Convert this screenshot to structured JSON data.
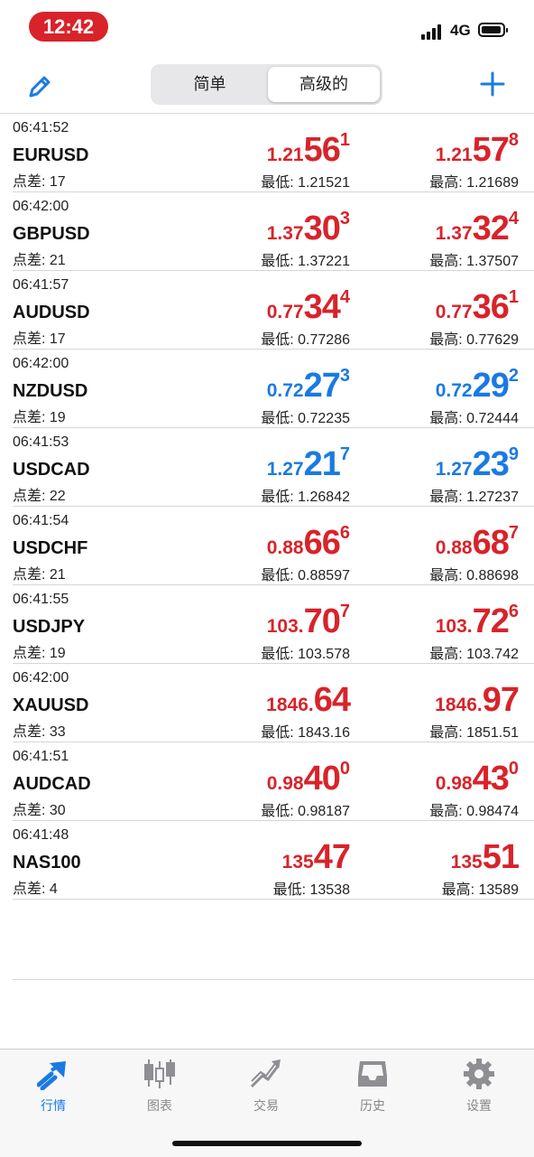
{
  "status": {
    "time": "12:42",
    "network": "4G"
  },
  "nav": {
    "segments": [
      "简单",
      "高级的"
    ],
    "selected_segment": "高级的",
    "edit_icon": "pencil-icon",
    "add_icon": "plus-icon"
  },
  "labels": {
    "low": "最低: ",
    "high": "最高: ",
    "spread": "点差: "
  },
  "quotes": [
    {
      "time": "06:41:52",
      "symbol": "EURUSD",
      "spread": "17",
      "color": "#d8232a",
      "bid": {
        "pre": "1.21",
        "big": "56",
        "sup": "1"
      },
      "ask": {
        "pre": "1.21",
        "big": "57",
        "sup": "8"
      },
      "low": "1.21521",
      "high": "1.21689"
    },
    {
      "time": "06:42:00",
      "symbol": "GBPUSD",
      "spread": "21",
      "color": "#d8232a",
      "bid": {
        "pre": "1.37",
        "big": "30",
        "sup": "3"
      },
      "ask": {
        "pre": "1.37",
        "big": "32",
        "sup": "4"
      },
      "low": "1.37221",
      "high": "1.37507"
    },
    {
      "time": "06:41:57",
      "symbol": "AUDUSD",
      "spread": "17",
      "color": "#d8232a",
      "bid": {
        "pre": "0.77",
        "big": "34",
        "sup": "4"
      },
      "ask": {
        "pre": "0.77",
        "big": "36",
        "sup": "1"
      },
      "low": "0.77286",
      "high": "0.77629"
    },
    {
      "time": "06:42:00",
      "symbol": "NZDUSD",
      "spread": "19",
      "color": "#1a7ae2",
      "bid": {
        "pre": "0.72",
        "big": "27",
        "sup": "3"
      },
      "ask": {
        "pre": "0.72",
        "big": "29",
        "sup": "2"
      },
      "low": "0.72235",
      "high": "0.72444"
    },
    {
      "time": "06:41:53",
      "symbol": "USDCAD",
      "spread": "22",
      "color": "#1a7ae2",
      "bid": {
        "pre": "1.27",
        "big": "21",
        "sup": "7"
      },
      "ask": {
        "pre": "1.27",
        "big": "23",
        "sup": "9"
      },
      "low": "1.26842",
      "high": "1.27237"
    },
    {
      "time": "06:41:54",
      "symbol": "USDCHF",
      "spread": "21",
      "color": "#d8232a",
      "bid": {
        "pre": "0.88",
        "big": "66",
        "sup": "6"
      },
      "ask": {
        "pre": "0.88",
        "big": "68",
        "sup": "7"
      },
      "low": "0.88597",
      "high": "0.88698"
    },
    {
      "time": "06:41:55",
      "symbol": "USDJPY",
      "spread": "19",
      "color": "#d8232a",
      "bid": {
        "pre": "103.",
        "big": "70",
        "sup": "7"
      },
      "ask": {
        "pre": "103.",
        "big": "72",
        "sup": "6"
      },
      "low": "103.578",
      "high": "103.742"
    },
    {
      "time": "06:42:00",
      "symbol": "XAUUSD",
      "spread": "33",
      "color": "#d8232a",
      "bid": {
        "pre": "1846.",
        "big": "64",
        "sup": ""
      },
      "ask": {
        "pre": "1846.",
        "big": "97",
        "sup": ""
      },
      "low": "1843.16",
      "high": "1851.51"
    },
    {
      "time": "06:41:51",
      "symbol": "AUDCAD",
      "spread": "30",
      "color": "#d8232a",
      "bid": {
        "pre": "0.98",
        "big": "40",
        "sup": "0"
      },
      "ask": {
        "pre": "0.98",
        "big": "43",
        "sup": "0"
      },
      "low": "0.98187",
      "high": "0.98474"
    },
    {
      "time": "06:41:48",
      "symbol": "NAS100",
      "spread": "4",
      "color": "#d8232a",
      "bid": {
        "pre": "135",
        "big": "47",
        "sup": ""
      },
      "ask": {
        "pre": "135",
        "big": "51",
        "sup": ""
      },
      "low": "13538",
      "high": "13589"
    }
  ],
  "tabs": [
    {
      "label": "行情",
      "icon": "quotes-icon",
      "active": true
    },
    {
      "label": "图表",
      "icon": "candlestick-chart-icon",
      "active": false
    },
    {
      "label": "交易",
      "icon": "trade-icon",
      "active": false
    },
    {
      "label": "历史",
      "icon": "history-inbox-icon",
      "active": false
    },
    {
      "label": "设置",
      "icon": "gear-icon",
      "active": false
    }
  ],
  "colors": {
    "accent": "#1a7ae2",
    "down": "#d8232a",
    "up": "#1a7ae2",
    "time_pill": "#d8232a"
  }
}
